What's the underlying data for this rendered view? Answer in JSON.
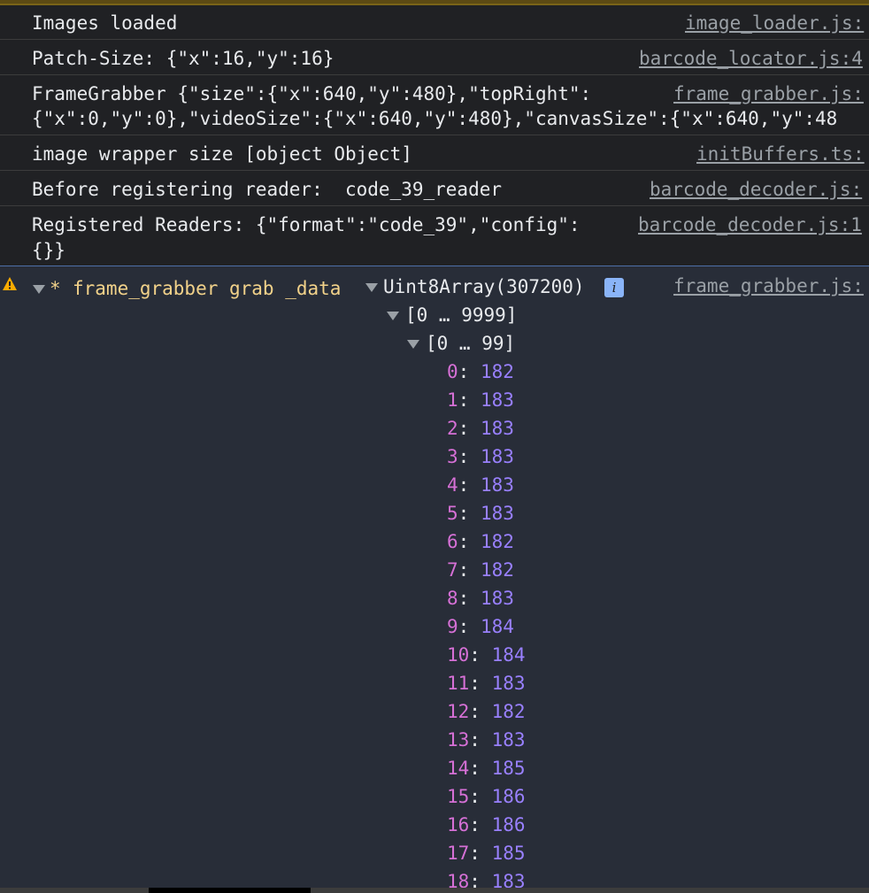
{
  "console": {
    "messages": [
      {
        "text": "Images loaded",
        "source": "image_loader.js:"
      },
      {
        "text": "Patch-Size: {\"x\":16,\"y\":16}",
        "source": "barcode_locator.js:4"
      },
      {
        "text": "FrameGrabber {\"size\":{\"x\":640,\"y\":480},\"topRight\":",
        "text2": "{\"x\":0,\"y\":0},\"videoSize\":{\"x\":640,\"y\":480},\"canvasSize\":{\"x\":640,\"y\":48",
        "source": "frame_grabber.js:"
      },
      {
        "text": "image wrapper size [object Object]",
        "source": "initBuffers.ts:"
      },
      {
        "text": "Before registering reader:  code_39_reader",
        "source": "barcode_decoder.js:"
      },
      {
        "text": "Registered Readers: {\"format\":\"code_39\",\"config\":",
        "text2": "{}}",
        "source": "barcode_decoder.js:1"
      }
    ],
    "warning": {
      "prefix": "*",
      "label": "frame_grabber grab _data",
      "object_type": "Uint8Array(307200)",
      "info_icon": "i",
      "source": "frame_grabber.js:",
      "range_outer": "[0 … 9999]",
      "range_inner": "[0 … 99]",
      "items": [
        {
          "index": "0",
          "value": "182"
        },
        {
          "index": "1",
          "value": "183"
        },
        {
          "index": "2",
          "value": "183"
        },
        {
          "index": "3",
          "value": "183"
        },
        {
          "index": "4",
          "value": "183"
        },
        {
          "index": "5",
          "value": "183"
        },
        {
          "index": "6",
          "value": "182"
        },
        {
          "index": "7",
          "value": "182"
        },
        {
          "index": "8",
          "value": "183"
        },
        {
          "index": "9",
          "value": "184"
        },
        {
          "index": "10",
          "value": "184"
        },
        {
          "index": "11",
          "value": "183"
        },
        {
          "index": "12",
          "value": "182"
        },
        {
          "index": "13",
          "value": "183"
        },
        {
          "index": "14",
          "value": "185"
        },
        {
          "index": "15",
          "value": "186"
        },
        {
          "index": "16",
          "value": "186"
        },
        {
          "index": "17",
          "value": "185"
        },
        {
          "index": "18",
          "value": "183"
        }
      ]
    }
  },
  "colors": {
    "background": "#202124",
    "warning_background": "#282d38",
    "warning_text": "#f2d28a",
    "index_color": "#d670d6",
    "value_color": "#9980ff",
    "link_color": "#9aa0a6"
  }
}
